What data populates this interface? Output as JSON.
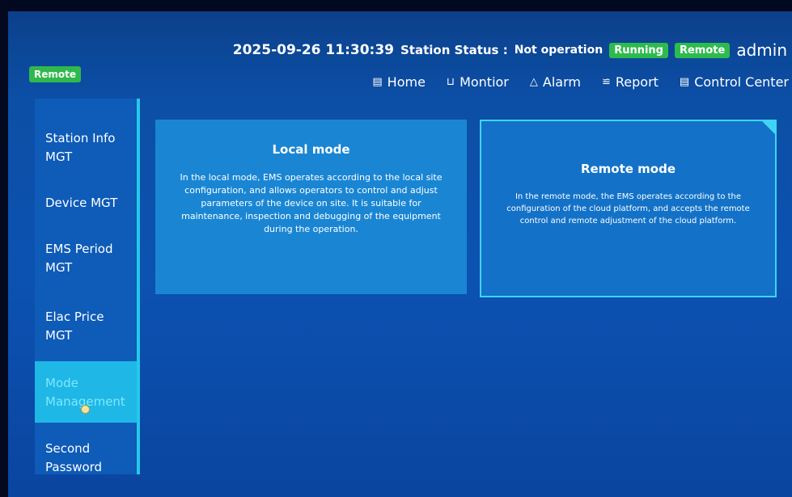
{
  "header": {
    "datetime": "2025-09-26 11:30:39",
    "station_status_label": "Station Status :",
    "station_status_value": "Not operation",
    "running_badge": "Running",
    "remote_badge": "Remote",
    "user": "admin"
  },
  "remote_button": "Remote",
  "nav": [
    {
      "label": "Home",
      "icon": "home-icon"
    },
    {
      "label": "Montior",
      "icon": "monitor-icon"
    },
    {
      "label": "Alarm",
      "icon": "alarm-icon"
    },
    {
      "label": "Report",
      "icon": "report-icon"
    },
    {
      "label": "Control Center",
      "icon": "control-center-icon"
    }
  ],
  "sidebar": {
    "items": [
      {
        "label1": "Station Info",
        "label2": "MGT"
      },
      {
        "label1": "Device MGT",
        "label2": ""
      },
      {
        "label1": "EMS Period",
        "label2": "MGT"
      },
      {
        "label1": "Elac Price",
        "label2": "MGT"
      },
      {
        "label1": "Mode",
        "label2": "Management"
      },
      {
        "label1": "Second",
        "label2": "Password"
      }
    ],
    "active_index": 4
  },
  "cards": {
    "local": {
      "title": "Local mode",
      "text": "In the local mode, EMS operates according to the local site configuration, and allows operators to control and adjust parameters of the device on site. It is suitable for maintenance, inspection and debugging of the equipment during the operation."
    },
    "remote": {
      "title": "Remote mode",
      "text": "In the remote mode, the EMS operates according to the configuration of the cloud platform, and accepts the remote control and remote adjustment of the cloud platform."
    }
  },
  "colors": {
    "accent": "#3fd4f4",
    "badge_green": "#2dbb4e",
    "active_item": "#1fb7e6"
  }
}
